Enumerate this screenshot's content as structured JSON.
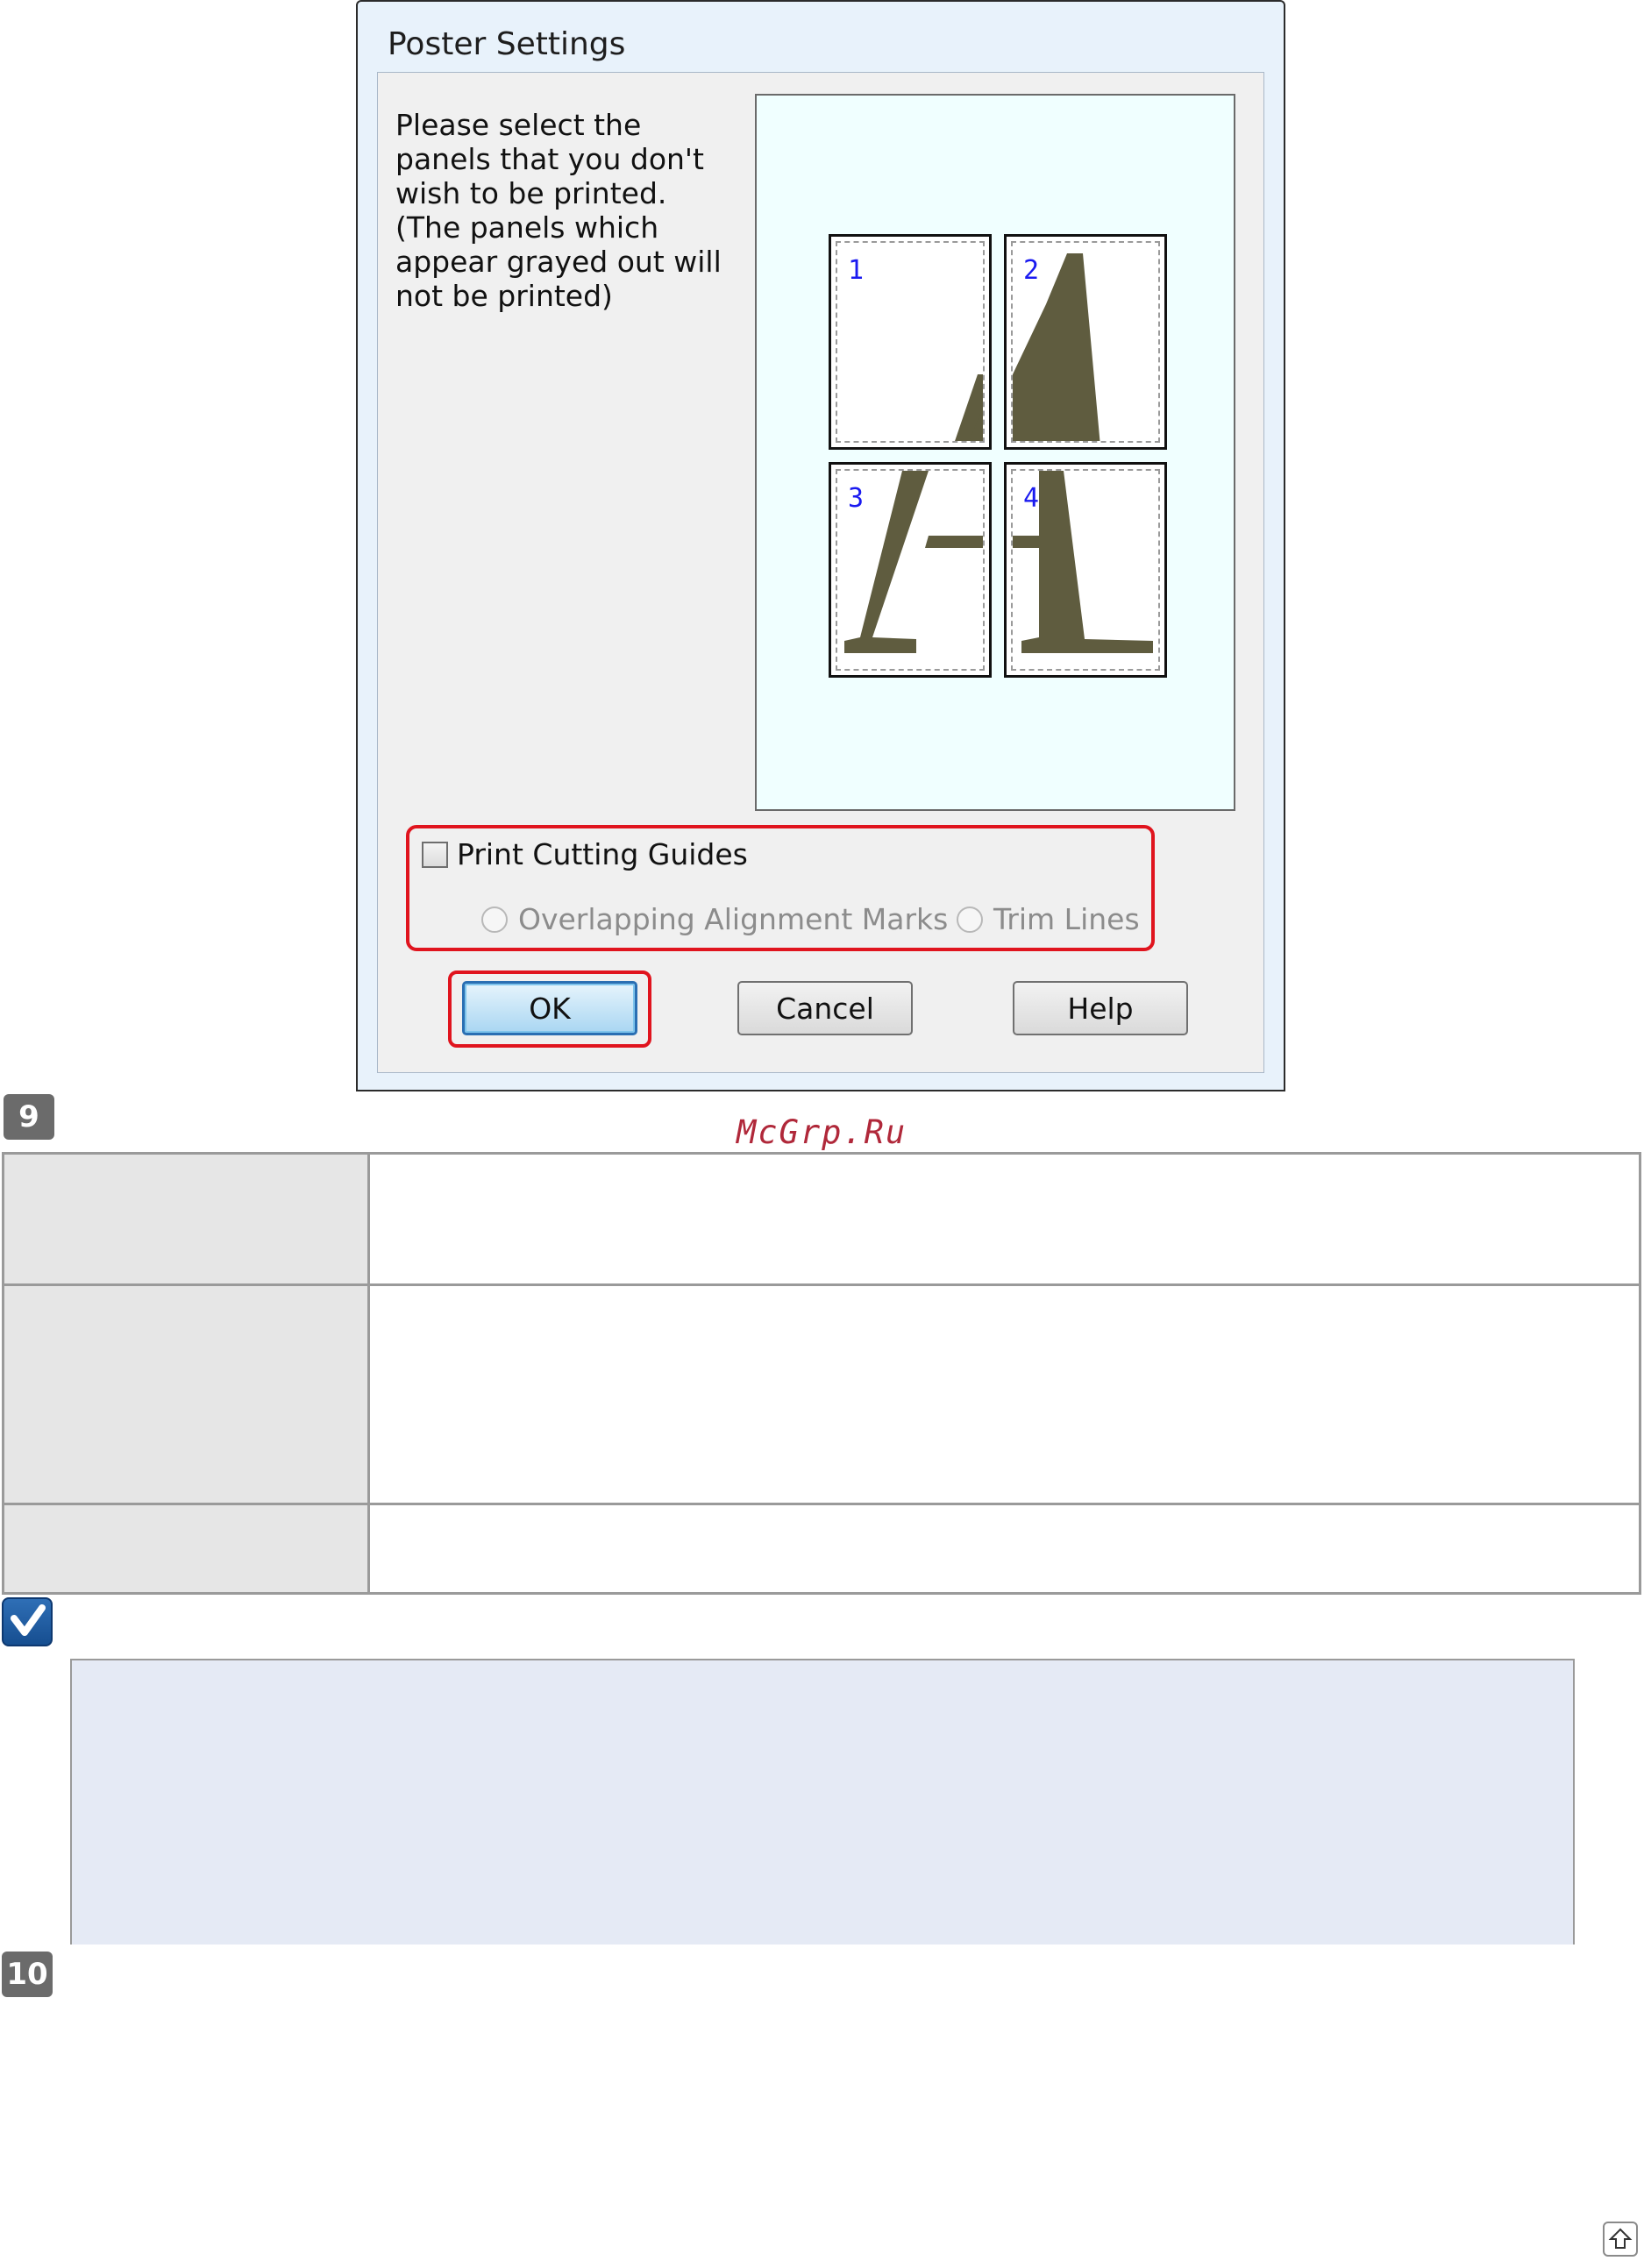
{
  "dialog": {
    "title": "Poster Settings",
    "instructions": "Please select the panels that you don't wish to be printed. (The panels which appear grayed out will not be printed)",
    "panels": [
      {
        "number": "1"
      },
      {
        "number": "2"
      },
      {
        "number": "3"
      },
      {
        "number": "4"
      }
    ],
    "print_cutting_guides": {
      "label": "Print Cutting Guides",
      "checked": false
    },
    "radio_options": [
      {
        "label": "Overlapping Alignment Marks",
        "enabled": false
      },
      {
        "label": "Trim Lines",
        "enabled": false
      }
    ],
    "buttons": {
      "ok": "OK",
      "cancel": "Cancel",
      "help": "Help"
    }
  },
  "page": {
    "step_9": "9",
    "watermark": "McGrp.Ru",
    "step_10": "10",
    "icons": {
      "note": "note-check-icon",
      "back_to_top": "back-to-top-icon"
    },
    "colors": {
      "highlight_frame": "#e0141e",
      "preview_background": "#f0ffff",
      "letter_fill": "#5f5c3f",
      "note_background": "#e5eaf5"
    }
  }
}
